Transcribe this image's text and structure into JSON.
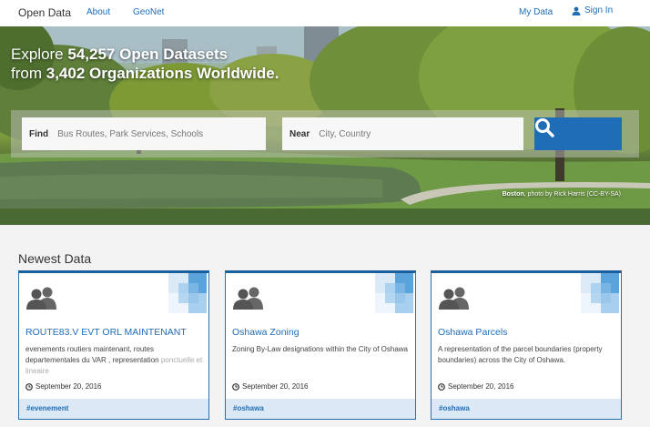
{
  "nav": {
    "brand": "Open Data",
    "about": "About",
    "geonet": "GeoNet",
    "my_data": "My Data",
    "sign_in": "Sign In"
  },
  "hero": {
    "line1_pre": "Explore ",
    "line1_bold": "54,257 Open Datasets",
    "line2_pre": "from ",
    "line2_bold": "3,402 Organizations Worldwide.",
    "credit_place": "Boston",
    "credit_rest": ", photo by Rick Harris (CC-BY-SA)"
  },
  "search": {
    "find_label": "Find",
    "find_placeholder": "Bus Routes, Park Services, Schools",
    "near_label": "Near",
    "near_placeholder": "City, Country",
    "button_icon": "search-icon"
  },
  "newest": {
    "title": "Newest Data",
    "cards": [
      {
        "title": "ROUTE83.V EVT ORL MAINTENANT",
        "desc": "evenements routiers maintenant, routes departementales du VAR , representation",
        "desc_fade": "ponctuelle et lineaire",
        "date": "September 20, 2016",
        "tag": "#evenement"
      },
      {
        "title": "Oshawa Zoning",
        "desc": "Zoning By-Law designations within the City of Oshawa",
        "desc_fade": "",
        "date": "September 20, 2016",
        "tag": "#oshawa"
      },
      {
        "title": "Oshawa Parcels",
        "desc": "A representation of the parcel boundaries (property boundaries) across the City of Oshawa.",
        "desc_fade": "",
        "date": "September 20, 2016",
        "tag": "#oshawa"
      }
    ]
  },
  "colors": {
    "accent": "#1f6db6",
    "tag_bar": "#dbe9f6"
  }
}
